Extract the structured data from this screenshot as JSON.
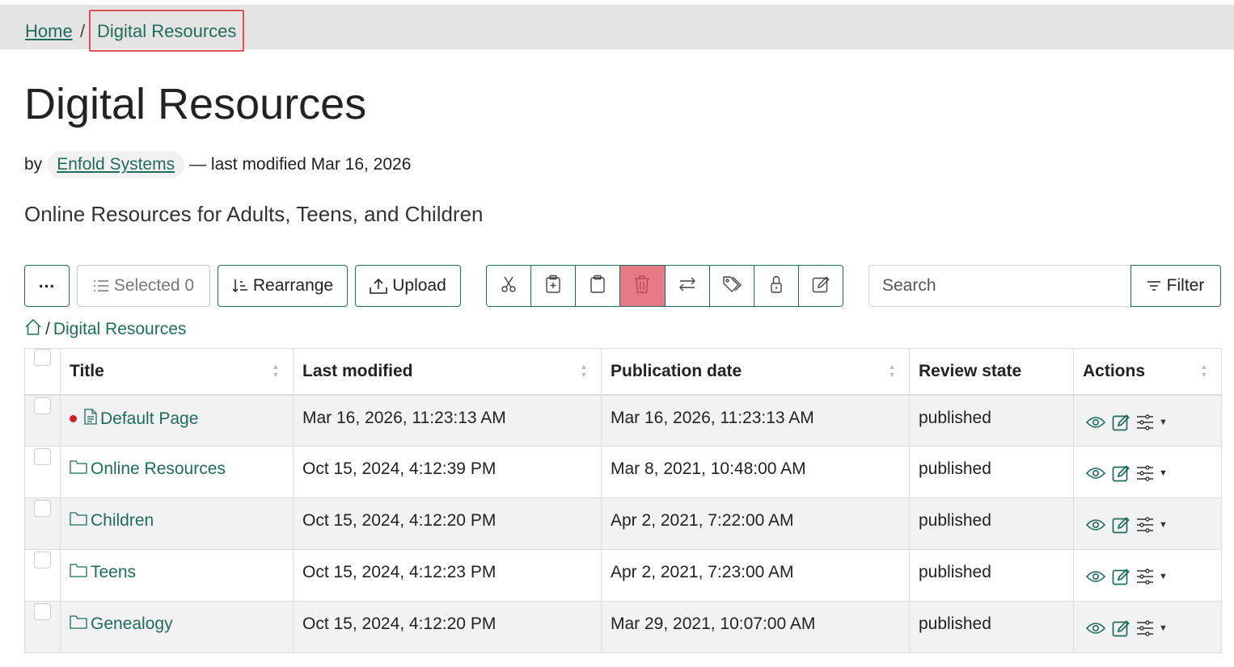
{
  "breadcrumb": {
    "home": "Home",
    "separator": "/",
    "current": "Digital Resources"
  },
  "page": {
    "title": "Digital Resources",
    "by": "by",
    "author": "Enfold Systems",
    "modified": "— last modified Mar 16, 2026",
    "description": "Online Resources for Adults, Teens, and Children"
  },
  "toolbar": {
    "more_label": "...",
    "selected_label": "Selected 0",
    "rearrange_label": "Rearrange",
    "upload_label": "Upload",
    "group_icons": [
      "cut-icon",
      "copy-icon",
      "paste-icon",
      "delete-icon",
      "rename-icon",
      "tags-icon",
      "lock-icon",
      "edit-icon"
    ],
    "search_placeholder": "Search",
    "filter_label": "Filter"
  },
  "path": {
    "separator": "/",
    "current": "Digital Resources"
  },
  "table": {
    "columns": [
      "Title",
      "Last modified",
      "Publication date",
      "Review state",
      "Actions"
    ],
    "rows": [
      {
        "title": "Default Page",
        "type": "page",
        "default": true,
        "modified": "Mar 16, 2026, 11:23:13 AM",
        "published": "Mar 16, 2026, 11:23:13 AM",
        "state": "published"
      },
      {
        "title": "Online Resources",
        "type": "folder",
        "default": false,
        "modified": "Oct 15, 2024, 4:12:39 PM",
        "published": "Mar 8, 2021, 10:48:00 AM",
        "state": "published"
      },
      {
        "title": "Children",
        "type": "folder",
        "default": false,
        "modified": "Oct 15, 2024, 4:12:20 PM",
        "published": "Apr 2, 2021, 7:22:00 AM",
        "state": "published"
      },
      {
        "title": "Teens",
        "type": "folder",
        "default": false,
        "modified": "Oct 15, 2024, 4:12:23 PM",
        "published": "Apr 2, 2021, 7:23:00 AM",
        "state": "published"
      },
      {
        "title": "Genealogy",
        "type": "folder",
        "default": false,
        "modified": "Oct 15, 2024, 4:12:20 PM",
        "published": "Mar 29, 2021, 10:07:00 AM",
        "state": "published"
      }
    ]
  },
  "colors": {
    "link": "#1f6b5c",
    "danger": "#e57a84",
    "highlight": "#e05050",
    "default_dot": "#cc1f2a"
  }
}
